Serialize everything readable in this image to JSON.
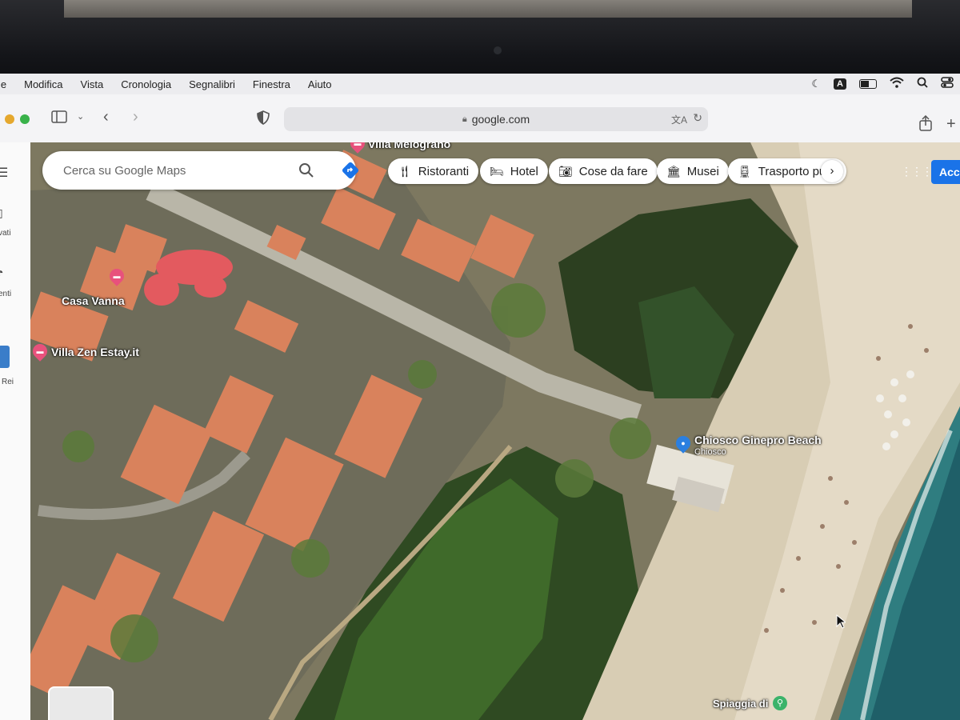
{
  "menubar": {
    "items": [
      "le",
      "Modifica",
      "Vista",
      "Cronologia",
      "Segnalibri",
      "Finestra",
      "Aiuto"
    ],
    "status_icons": [
      "moon-icon",
      "input-a-icon",
      "battery-icon",
      "wifi-icon",
      "search-icon",
      "control-center-icon"
    ],
    "input_source": "A"
  },
  "toolbar": {
    "url": "google.com",
    "icons": [
      "sidebar-icon",
      "chevron-down-icon",
      "back-icon",
      "forward-icon",
      "shield-icon",
      "lock-icon",
      "translate-icon",
      "reload-icon",
      "share-icon",
      "new-tab-icon"
    ]
  },
  "sidebar": {
    "items": [
      {
        "label": "vati",
        "icon": "bookmark-icon"
      },
      {
        "label": "enti",
        "icon": "history-icon"
      },
      {
        "label": "Rei",
        "icon": "thumbnail-icon"
      }
    ]
  },
  "maps": {
    "search_placeholder": "Cerca su Google Maps",
    "chips": [
      {
        "label": "Ristoranti",
        "icon": "fork-knife-icon"
      },
      {
        "label": "Hotel",
        "icon": "bed-icon"
      },
      {
        "label": "Cose da fare",
        "icon": "camera-icon"
      },
      {
        "label": "Musei",
        "icon": "museum-icon"
      },
      {
        "label": "Trasporto pul",
        "icon": "train-icon"
      }
    ],
    "signin_label": "Acc",
    "places": {
      "villa_melograno": "Villa Melograno",
      "casa_vanna": "Casa Vanna",
      "villa_zen": "Villa Zen Estay.it",
      "chiosco": "Chiosco Ginepro Beach",
      "chiosco_sub": "Chiosco",
      "spiaggia": "Spiaggia di"
    },
    "colors": {
      "hotel_pin": "#e8517c",
      "beach_pin": "#2a7fe0",
      "accent_button": "#1a73e8",
      "redaction": "#e35a5f"
    }
  }
}
